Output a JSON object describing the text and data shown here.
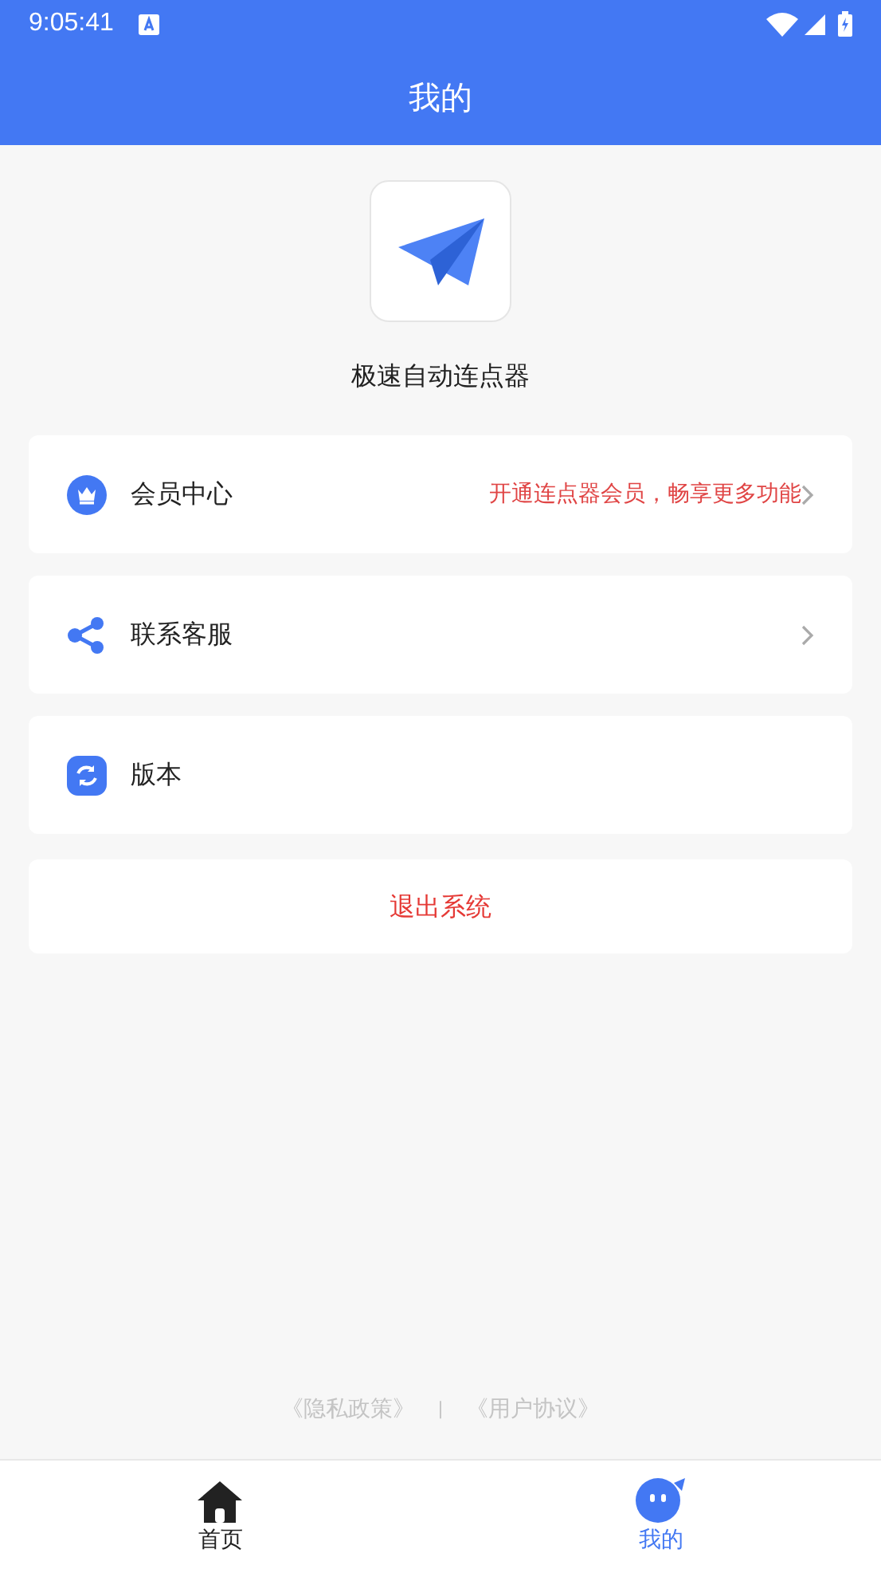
{
  "status_bar": {
    "time": "9:05:41"
  },
  "header": {
    "title": "我的"
  },
  "app": {
    "name": "极速自动连点器"
  },
  "menu": [
    {
      "label": "会员中心",
      "note": "开通连点器会员，畅享更多功能",
      "chevron": true
    },
    {
      "label": "联系客服",
      "chevron": true
    },
    {
      "label": "版本",
      "chevron": false
    }
  ],
  "logout": {
    "label": "退出系统"
  },
  "footer": {
    "links": [
      "《隐私政策》",
      "《用户协议》"
    ],
    "separator": "|"
  },
  "tabs": [
    {
      "label": "首页",
      "selected": false
    },
    {
      "label": "我的",
      "selected": true
    }
  ]
}
